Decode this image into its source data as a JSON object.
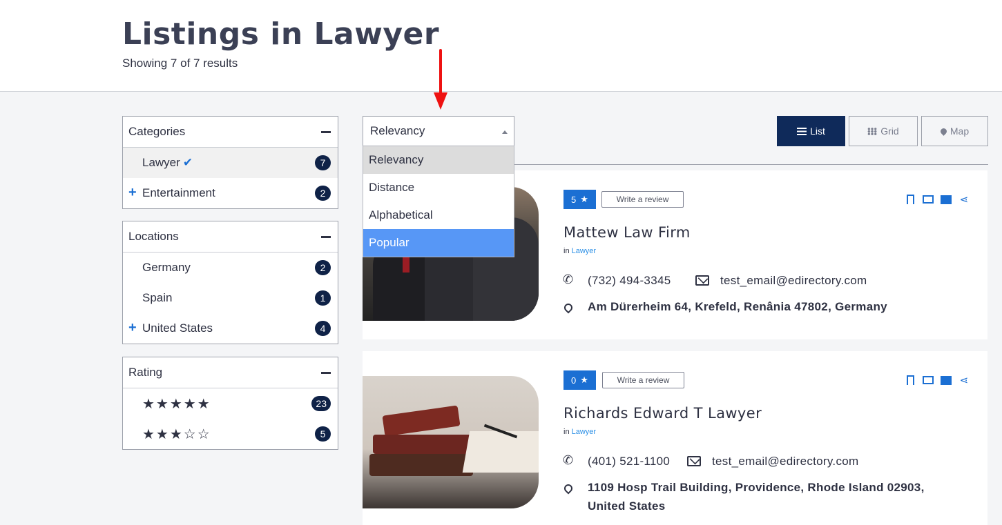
{
  "header": {
    "title": "Listings in Lawyer",
    "subtitle": "Showing 7 of 7 results"
  },
  "sidebar": {
    "categories": {
      "title": "Categories",
      "items": [
        {
          "label": "Lawyer",
          "count": "7",
          "selected": true
        },
        {
          "label": "Entertainment",
          "count": "2",
          "expandable": true
        }
      ]
    },
    "locations": {
      "title": "Locations",
      "items": [
        {
          "label": "Germany",
          "count": "2"
        },
        {
          "label": "Spain",
          "count": "1"
        },
        {
          "label": "United States",
          "count": "4",
          "expandable": true
        }
      ]
    },
    "rating": {
      "title": "Rating",
      "items": [
        {
          "stars": "★★★★★",
          "count": "23",
          "value": 5
        },
        {
          "stars": "★★★☆☆",
          "count": "5",
          "value": 3
        }
      ]
    }
  },
  "sort": {
    "selected": "Relevancy",
    "options": [
      "Relevancy",
      "Distance",
      "Alphabetical",
      "Popular"
    ],
    "highlighted": "Popular"
  },
  "view": {
    "list": "List",
    "grid": "Grid",
    "map": "Map",
    "active": "List"
  },
  "listings": [
    {
      "rating": "5",
      "review_label": "Write a review",
      "title": "Mattew Law Firm",
      "in_label": "in",
      "category": "Lawyer",
      "phone": "(732) 494-3345",
      "email": "test_email@edirectory.com",
      "address": "Am Dürerheim 64, Krefeld, Renânia 47802, Germany"
    },
    {
      "rating": "0",
      "review_label": "Write a review",
      "title": "Richards Edward T Lawyer",
      "in_label": "in",
      "category": "Lawyer",
      "phone": "(401) 521-1100",
      "email": "test_email@edirectory.com",
      "address_line1": "1109 Hosp Trail Building, Providence, Rhode Island 02903,",
      "address_line2": "United States"
    }
  ],
  "colors": {
    "accent": "#1b6fd3",
    "navy": "#0f2247",
    "dropdown_highlight": "#5797f6",
    "annotation_arrow": "#ee1111"
  }
}
